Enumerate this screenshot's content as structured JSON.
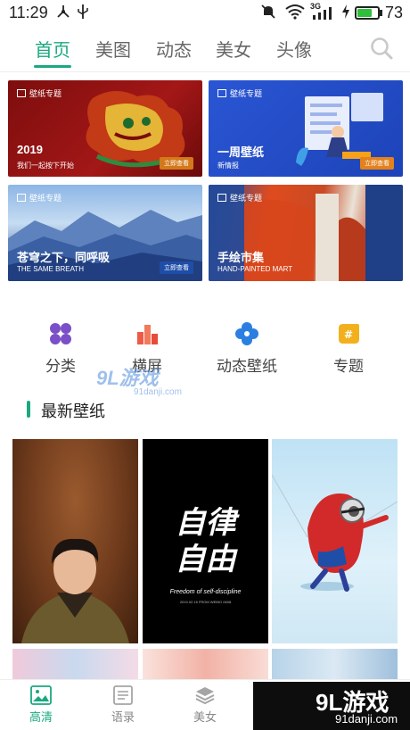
{
  "status_bar": {
    "time": "11:29",
    "network": "3G",
    "battery_level": 73,
    "battery_label": "73",
    "accent": "#2fbf3a"
  },
  "tabs": [
    {
      "label": "首页",
      "active": true
    },
    {
      "label": "美图",
      "active": false
    },
    {
      "label": "动态",
      "active": false
    },
    {
      "label": "美女",
      "active": false
    },
    {
      "label": "头像",
      "active": false
    }
  ],
  "accent_color": "#1aa880",
  "banners": [
    {
      "tag": "壁纸专题",
      "title": "2019",
      "subtitle": "我们一起按下开始",
      "button": "立即查看"
    },
    {
      "tag": "壁纸专题",
      "title": "一周壁纸",
      "subtitle": "新情报",
      "button": "立即查看"
    },
    {
      "tag": "壁纸专题",
      "title": "苍穹之下，同呼吸",
      "subtitle": "THE SAME BREATH",
      "button": "立即查看"
    },
    {
      "tag": "壁纸专题",
      "title": "手绘市集",
      "subtitle": "HAND-PAINTED MART",
      "button": ""
    }
  ],
  "categories": [
    {
      "label": "分类",
      "icon": "four-dots-icon",
      "color": "#7a4fc7"
    },
    {
      "label": "横屏",
      "icon": "bar-chart-icon",
      "color": "#ee5a45"
    },
    {
      "label": "动态壁纸",
      "icon": "flower-icon",
      "color": "#2b7fe0"
    },
    {
      "label": "专题",
      "icon": "hash-icon",
      "color": "#f2b11c"
    }
  ],
  "watermark": {
    "logo": "9L游戏",
    "url": "91danji.com"
  },
  "section": {
    "title": "最新壁纸"
  },
  "wallpapers": [
    {
      "name": "portrait"
    },
    {
      "name": "text-poster",
      "line1": "自律",
      "line2": "自由",
      "caption": "Freedom of self-discipline",
      "credit": "2019.02.15 FROM WEIBO 0608"
    },
    {
      "name": "superhero-minion"
    }
  ],
  "bottom_nav": [
    {
      "label": "高清",
      "icon": "image-icon",
      "active": true
    },
    {
      "label": "语录",
      "icon": "list-icon",
      "active": false
    },
    {
      "label": "美女",
      "icon": "layers-icon",
      "active": false
    }
  ],
  "corner_watermark": {
    "logo": "9L游戏",
    "url": "91danji.com"
  }
}
